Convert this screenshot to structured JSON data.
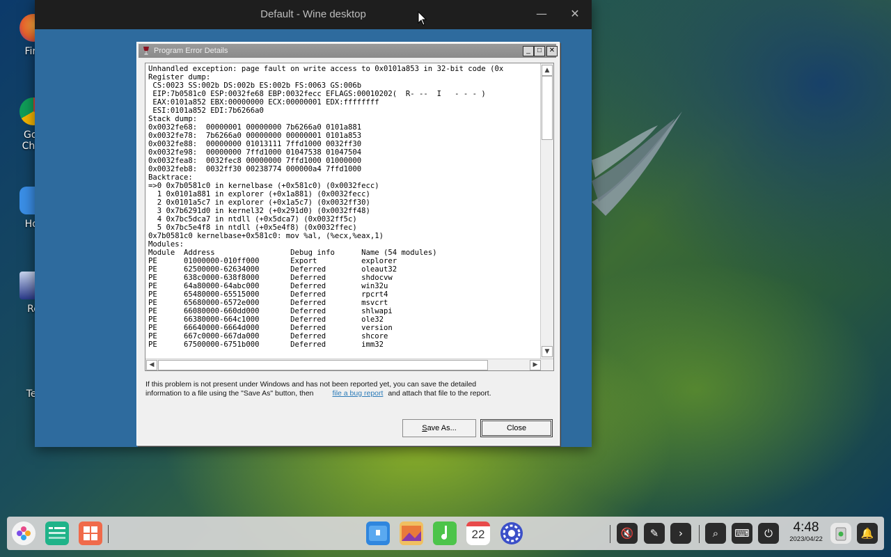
{
  "desktop_icons": [
    {
      "label": "Fire",
      "color": "#e8602c"
    },
    {
      "label": "Goo\nChro",
      "color": "#db4437"
    },
    {
      "label": "Hor",
      "color": "#3a8ee6"
    },
    {
      "label": "Ro",
      "color": "#2a3a8a"
    },
    {
      "label": "Ter",
      "color": "#5a6a7a"
    }
  ],
  "wine_window": {
    "title": "Default - Wine desktop",
    "minimize_glyph": "—",
    "close_glyph": "✕"
  },
  "dialog": {
    "title": "Program Error Details",
    "min_glyph": "_",
    "max_glyph": "□",
    "close_glyph": "✕",
    "log_text": "Unhandled exception: page fault on write access to 0x0101a853 in 32-bit code (0x\nRegister dump:\n CS:0023 SS:002b DS:002b ES:002b FS:0063 GS:006b\n EIP:7b0581c0 ESP:0032fe68 EBP:0032fecc EFLAGS:00010202(  R- --  I   - - - )\n EAX:0101a852 EBX:00000000 ECX:00000001 EDX:ffffffff\n ESI:0101a852 EDI:7b6266a0\nStack dump:\n0x0032fe68:  00000001 00000000 7b6266a0 0101a881\n0x0032fe78:  7b6266a0 00000000 00000001 0101a853\n0x0032fe88:  00000000 01013111 7ffd1000 0032ff30\n0x0032fe98:  00000000 7ffd1000 01047538 01047504\n0x0032fea8:  0032fec8 00000000 7ffd1000 01000000\n0x0032feb8:  0032ff30 00238774 000000a4 7ffd1000\nBacktrace:\n=>0 0x7b0581c0 in kernelbase (+0x581c0) (0x0032fecc)\n  1 0x0101a881 in explorer (+0x1a881) (0x0032fecc)\n  2 0x0101a5c7 in explorer (+0x1a5c7) (0x0032ff30)\n  3 0x7b6291d0 in kernel32 (+0x291d0) (0x0032ff48)\n  4 0x7bc5dca7 in ntdll (+0x5dca7) (0x0032ff5c)\n  5 0x7bc5e4f8 in ntdll (+0x5e4f8) (0x0032ffec)\n0x7b0581c0 kernelbase+0x581c0: mov %al, (%ecx,%eax,1)\nModules:\nModule  Address                 Debug info      Name (54 modules)\nPE      01000000-010ff000       Export          explorer\nPE      62500000-62634000       Deferred        oleaut32\nPE      638c0000-638f8000       Deferred        shdocvw\nPE      64a80000-64abc000       Deferred        win32u\nPE      65480000-65515000       Deferred        rpcrt4\nPE      65680000-6572e000       Deferred        msvcrt\nPE      66080000-660dd000       Deferred        shlwapi\nPE      66380000-664c1000       Deferred        ole32\nPE      66640000-6664d000       Deferred        version\nPE      667c0000-667da000       Deferred        shcore\nPE      67500000-6751b000       Deferred        imm32",
    "info_line1": "If this problem is not present under Windows and has not been reported yet, you can save the detailed",
    "info_line2_prefix": "information to a file using the \"Save As\" button, then",
    "info_link": "file a bug report",
    "info_line2_suffix": "and attach that file to the report.",
    "save_button": {
      "underlined": "S",
      "rest": "ave As..."
    },
    "close_button": "Close",
    "scroll_up": "▲",
    "scroll_down": "▼",
    "scroll_left": "◀",
    "scroll_right": "▶"
  },
  "dock": {
    "left_apps": [
      {
        "name": "launcher-icon",
        "color": "#f5f5f5"
      },
      {
        "name": "terminal-icon",
        "color": "#1fb389"
      },
      {
        "name": "app-store-icon",
        "color": "#f06a4a"
      }
    ],
    "center_apps": [
      {
        "name": "file-manager-icon",
        "color": "#2f86de"
      },
      {
        "name": "image-viewer-icon",
        "color": "#e9a13a"
      },
      {
        "name": "music-icon",
        "color": "#4dc44a"
      },
      {
        "name": "calendar-icon",
        "color": "#ffffff"
      },
      {
        "name": "settings-icon",
        "color": "#3b4fc8"
      }
    ],
    "calendar_day": "22",
    "tray_glyphs": {
      "volume": "🔇",
      "pen": "✎",
      "expand": "›",
      "search": "⌕",
      "keyboard": "⌨",
      "power": "⏻",
      "bell": "🔔"
    },
    "time": "4:48",
    "date": "2023/04/22"
  }
}
